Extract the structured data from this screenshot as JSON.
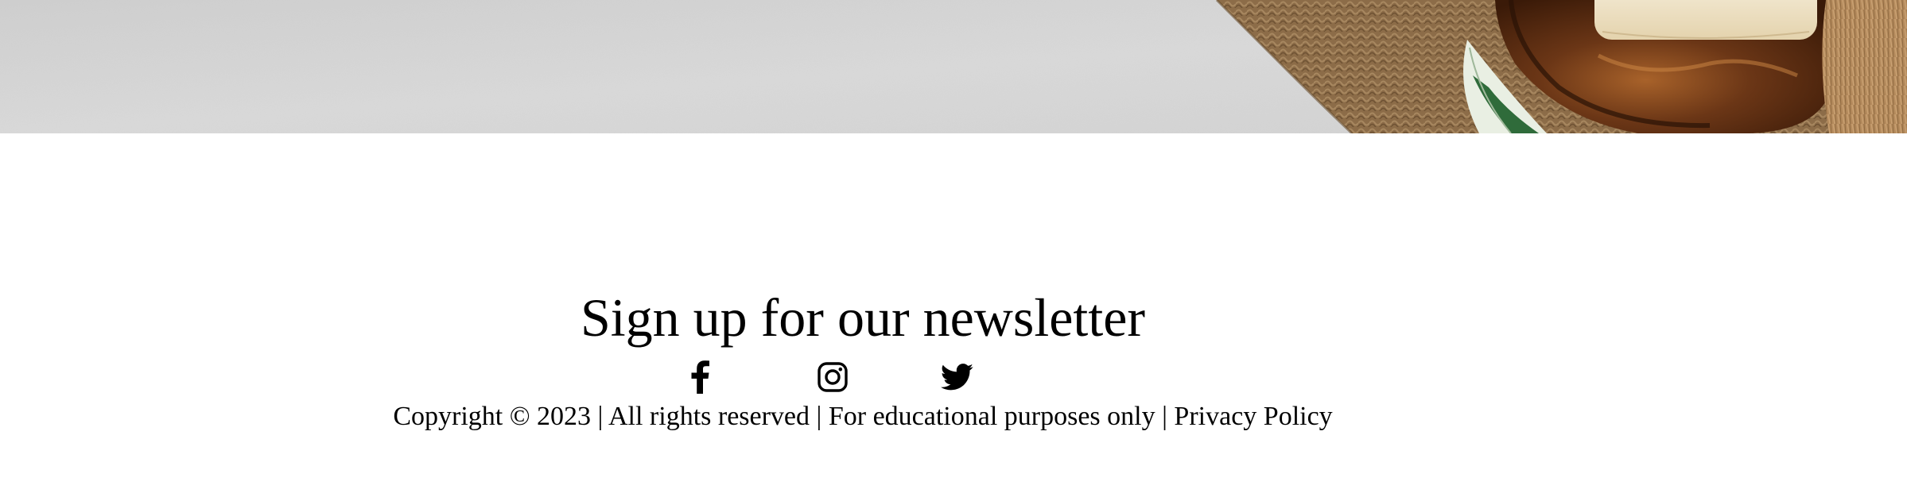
{
  "hero": {
    "image_description_icon": "spa-photo"
  },
  "newsletter": {
    "title": "Sign up for our newsletter"
  },
  "social": [
    {
      "name": "facebook-icon"
    },
    {
      "name": "instagram-icon"
    },
    {
      "name": "twitter-icon"
    }
  ],
  "footer": {
    "copyright": "Copyright © 2023",
    "separator": "|",
    "rights": "All rights reserved",
    "educational": "For educational purposes only",
    "privacy_link": "Privacy Policy"
  },
  "colors": {
    "background": "#ffffff",
    "text": "#000000",
    "hero_stone": "#d4d4d4",
    "hero_towel": "#8a6a45",
    "hero_wood": "#5a2f12",
    "hero_soap": "#f1e6cc",
    "hero_leaf": "#2f6b3a"
  }
}
